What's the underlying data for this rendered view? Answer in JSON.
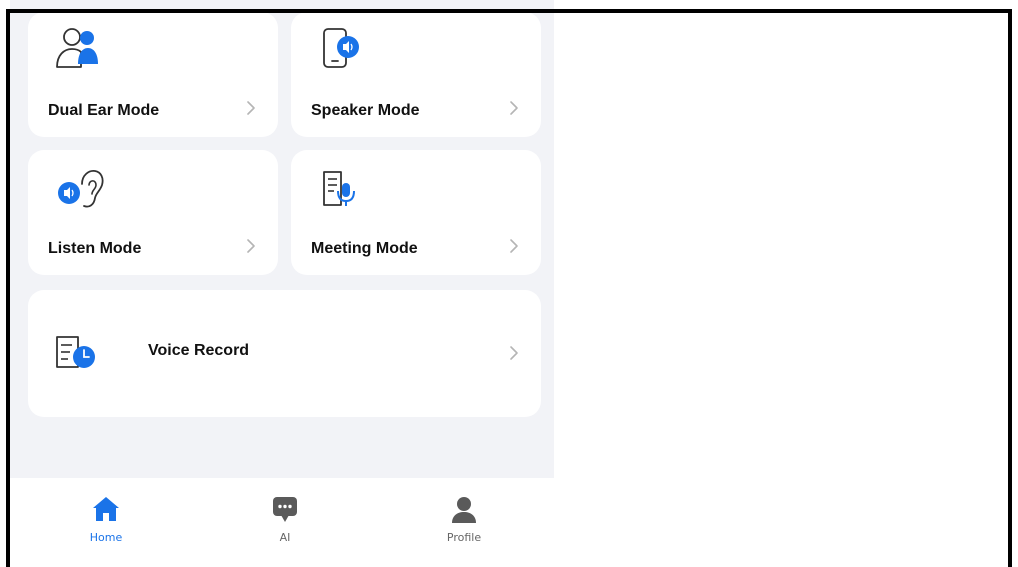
{
  "colors": {
    "accent": "#1a73e8",
    "icon_outline": "#333333",
    "background": "#f2f3f7",
    "card": "#ffffff",
    "tab_inactive": "#5a5a5a"
  },
  "modes": [
    {
      "label": "Dual Ear Mode",
      "icon": "dual-ear-people-icon"
    },
    {
      "label": "Speaker Mode",
      "icon": "phone-speaker-icon"
    },
    {
      "label": "Listen Mode",
      "icon": "ear-sound-icon"
    },
    {
      "label": "Meeting Mode",
      "icon": "document-mic-icon"
    }
  ],
  "voice_record": {
    "label": "Voice Record",
    "icon": "document-clock-icon"
  },
  "tabbar": {
    "selected": "Home",
    "tabs": [
      {
        "label": "Home",
        "icon": "home-icon"
      },
      {
        "label": "AI",
        "icon": "chat-bubble-icon"
      },
      {
        "label": "Profile",
        "icon": "person-icon"
      }
    ]
  }
}
